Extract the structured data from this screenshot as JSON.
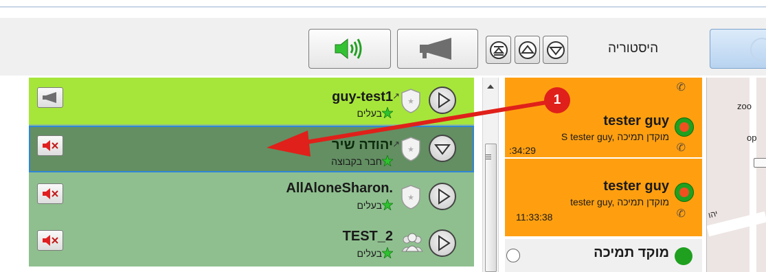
{
  "toolbar": {
    "history_label": "היסטוריה"
  },
  "users": [
    {
      "name": "guy-test1",
      "role": "בעלים",
      "status": "active",
      "volume_icon": "megaphone-icon",
      "action_icon": "play-icon"
    },
    {
      "name": "יהודה שיר",
      "role": "חבר בקבוצה",
      "status": "selected",
      "volume_icon": "muted-speaker-icon",
      "action_icon": "chevron-down-icon"
    },
    {
      "name": "AllAloneSharon.",
      "role": "בעלים",
      "status": "idle",
      "volume_icon": "muted-speaker-icon",
      "action_icon": "play-icon"
    },
    {
      "name": "TEST_2",
      "role": "בעלים",
      "status": "idle",
      "volume_icon": "muted-speaker-icon",
      "action_icon": "play-icon"
    }
  ],
  "calls": [
    {
      "title": "tester guy",
      "detail": "S tester guy, מוקדן תמיכה",
      "time": ":34:29"
    },
    {
      "title": "tester guy",
      "detail": "tester guy, מוקדן תמיכה",
      "time": "11:33:38"
    },
    {
      "title": "מוקד תמיכה"
    }
  ],
  "map": {
    "label_zoom": "zoo",
    "label_op": "op",
    "street_fragment": "יהו"
  },
  "annotation": {
    "step_number": "1"
  },
  "colors": {
    "green_row": "#a6e63a",
    "list_bg": "#8fbf8f",
    "selected_row": "#638f63",
    "selection_border": "#2f86d8",
    "call_orange": "#ff9f10",
    "annotation_red": "#e0201a"
  }
}
